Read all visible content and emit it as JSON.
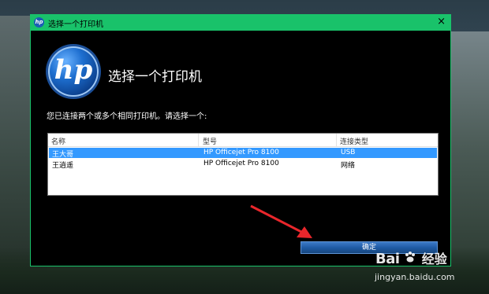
{
  "window": {
    "title": "选择一个打印机",
    "close_glyph": "×"
  },
  "brand": {
    "logo_text": "hp"
  },
  "header": {
    "title": "选择一个打印机"
  },
  "prompt": "您已连接两个或多个相同打印机。请选择一个:",
  "list": {
    "columns": [
      "名称",
      "型号",
      "连接类型"
    ],
    "rows": [
      {
        "name": "王大哥",
        "model": "HP Officejet Pro 8100",
        "connection": "USB",
        "selected": true
      },
      {
        "name": "王逍遥",
        "model": "HP Officejet Pro 8100",
        "connection": "网络",
        "selected": false
      }
    ]
  },
  "ok_button": {
    "label": "确定"
  },
  "watermark": {
    "brand": "Bai",
    "brand2": "经验",
    "url": "jingyan.baidu.com"
  },
  "colors": {
    "title_bar": "#19c26a",
    "selection": "#3399ff",
    "annotation_arrow": "#e8262b",
    "button": "#1f5ba6"
  },
  "icons": [
    "hp-logo-icon",
    "close-icon",
    "baidu-paw-icon",
    "annotation-arrow"
  ]
}
